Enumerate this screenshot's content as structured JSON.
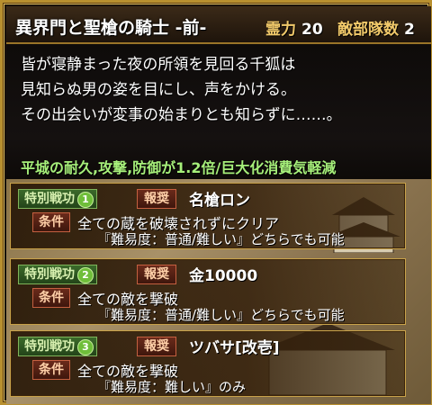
{
  "header": {
    "title": "異界門と聖槍の騎士 -前-",
    "power_label": "霊力",
    "power_value": "20",
    "units_label": "敵部隊数",
    "units_value": "2"
  },
  "description": {
    "lines": [
      "皆が寝静まった夜の所領を見回る千狐は",
      "見知らぬ男の姿を目にし、声をかける。",
      "その出会いが変事の始まりとも知らずに……。"
    ],
    "effect": "平城の耐久,攻撃,防御が1.2倍/巨大化消費気軽減"
  },
  "cards": [
    {
      "special_label": "特別戦功",
      "number": "1",
      "reward_label": "報奨",
      "reward": "名槍ロン",
      "condition_label": "条件",
      "condition": "全ての蔵を破壊されずにクリア",
      "difficulty": "『難易度：普通/難しい』どちらでも可能"
    },
    {
      "special_label": "特別戦功",
      "number": "2",
      "reward_label": "報奨",
      "reward": "金10000",
      "condition_label": "条件",
      "condition": "全ての敵を撃破",
      "difficulty": "『難易度：普通/難しい』どちらでも可能"
    },
    {
      "special_label": "特別戦功",
      "number": "3",
      "reward_label": "報奨",
      "reward": "ツバサ[改壱]",
      "condition_label": "条件",
      "condition": "全ての敵を撃破",
      "difficulty": "『難易度：難しい』のみ"
    }
  ],
  "colors": {
    "gold_border": "#b8902f",
    "effect_green": "#a6ef7a",
    "label_gold": "#f1c96a"
  }
}
